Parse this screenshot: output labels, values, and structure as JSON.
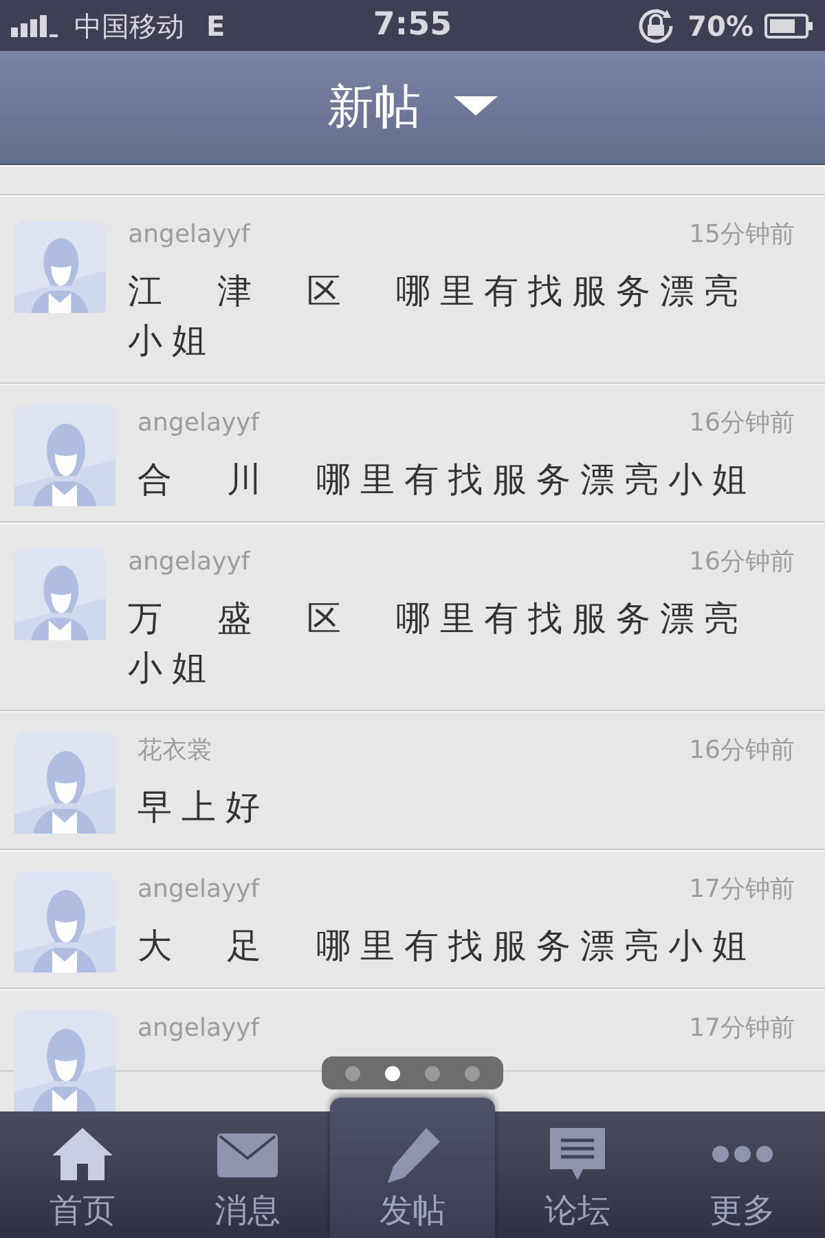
{
  "status_bar": {
    "carrier": "中国移动",
    "network": "E",
    "time": "7:55",
    "battery": "70%"
  },
  "nav": {
    "title": "新帖"
  },
  "posts": [
    {
      "author": "angelayyf",
      "time": "15分钟前",
      "title": "江 津 区 哪里有找服务漂亮小姐"
    },
    {
      "author": "angelayyf",
      "time": "16分钟前",
      "title": "合 川 哪里有找服务漂亮小姐"
    },
    {
      "author": "angelayyf",
      "time": "16分钟前",
      "title": "万 盛 区 哪里有找服务漂亮小姐"
    },
    {
      "author": "花衣裳",
      "time": "16分钟前",
      "title": "早上好"
    },
    {
      "author": "angelayyf",
      "time": "17分钟前",
      "title": "大 足 哪里有找服务漂亮小姐"
    },
    {
      "author": "angelayyf",
      "time": "17分钟前"
    }
  ],
  "pager": [
    {
      "selected": false
    },
    {
      "selected": true
    },
    {
      "selected": false
    },
    {
      "selected": false
    }
  ],
  "tabs": [
    {
      "kind": "home",
      "label": "首页",
      "selected": false
    },
    {
      "kind": "mail",
      "label": "消息",
      "selected": false
    },
    {
      "kind": "pencil",
      "label": "发帖",
      "selected": true
    },
    {
      "kind": "forum",
      "label": "论坛",
      "selected": false
    },
    {
      "kind": "more",
      "label": "更多",
      "selected": false
    }
  ]
}
